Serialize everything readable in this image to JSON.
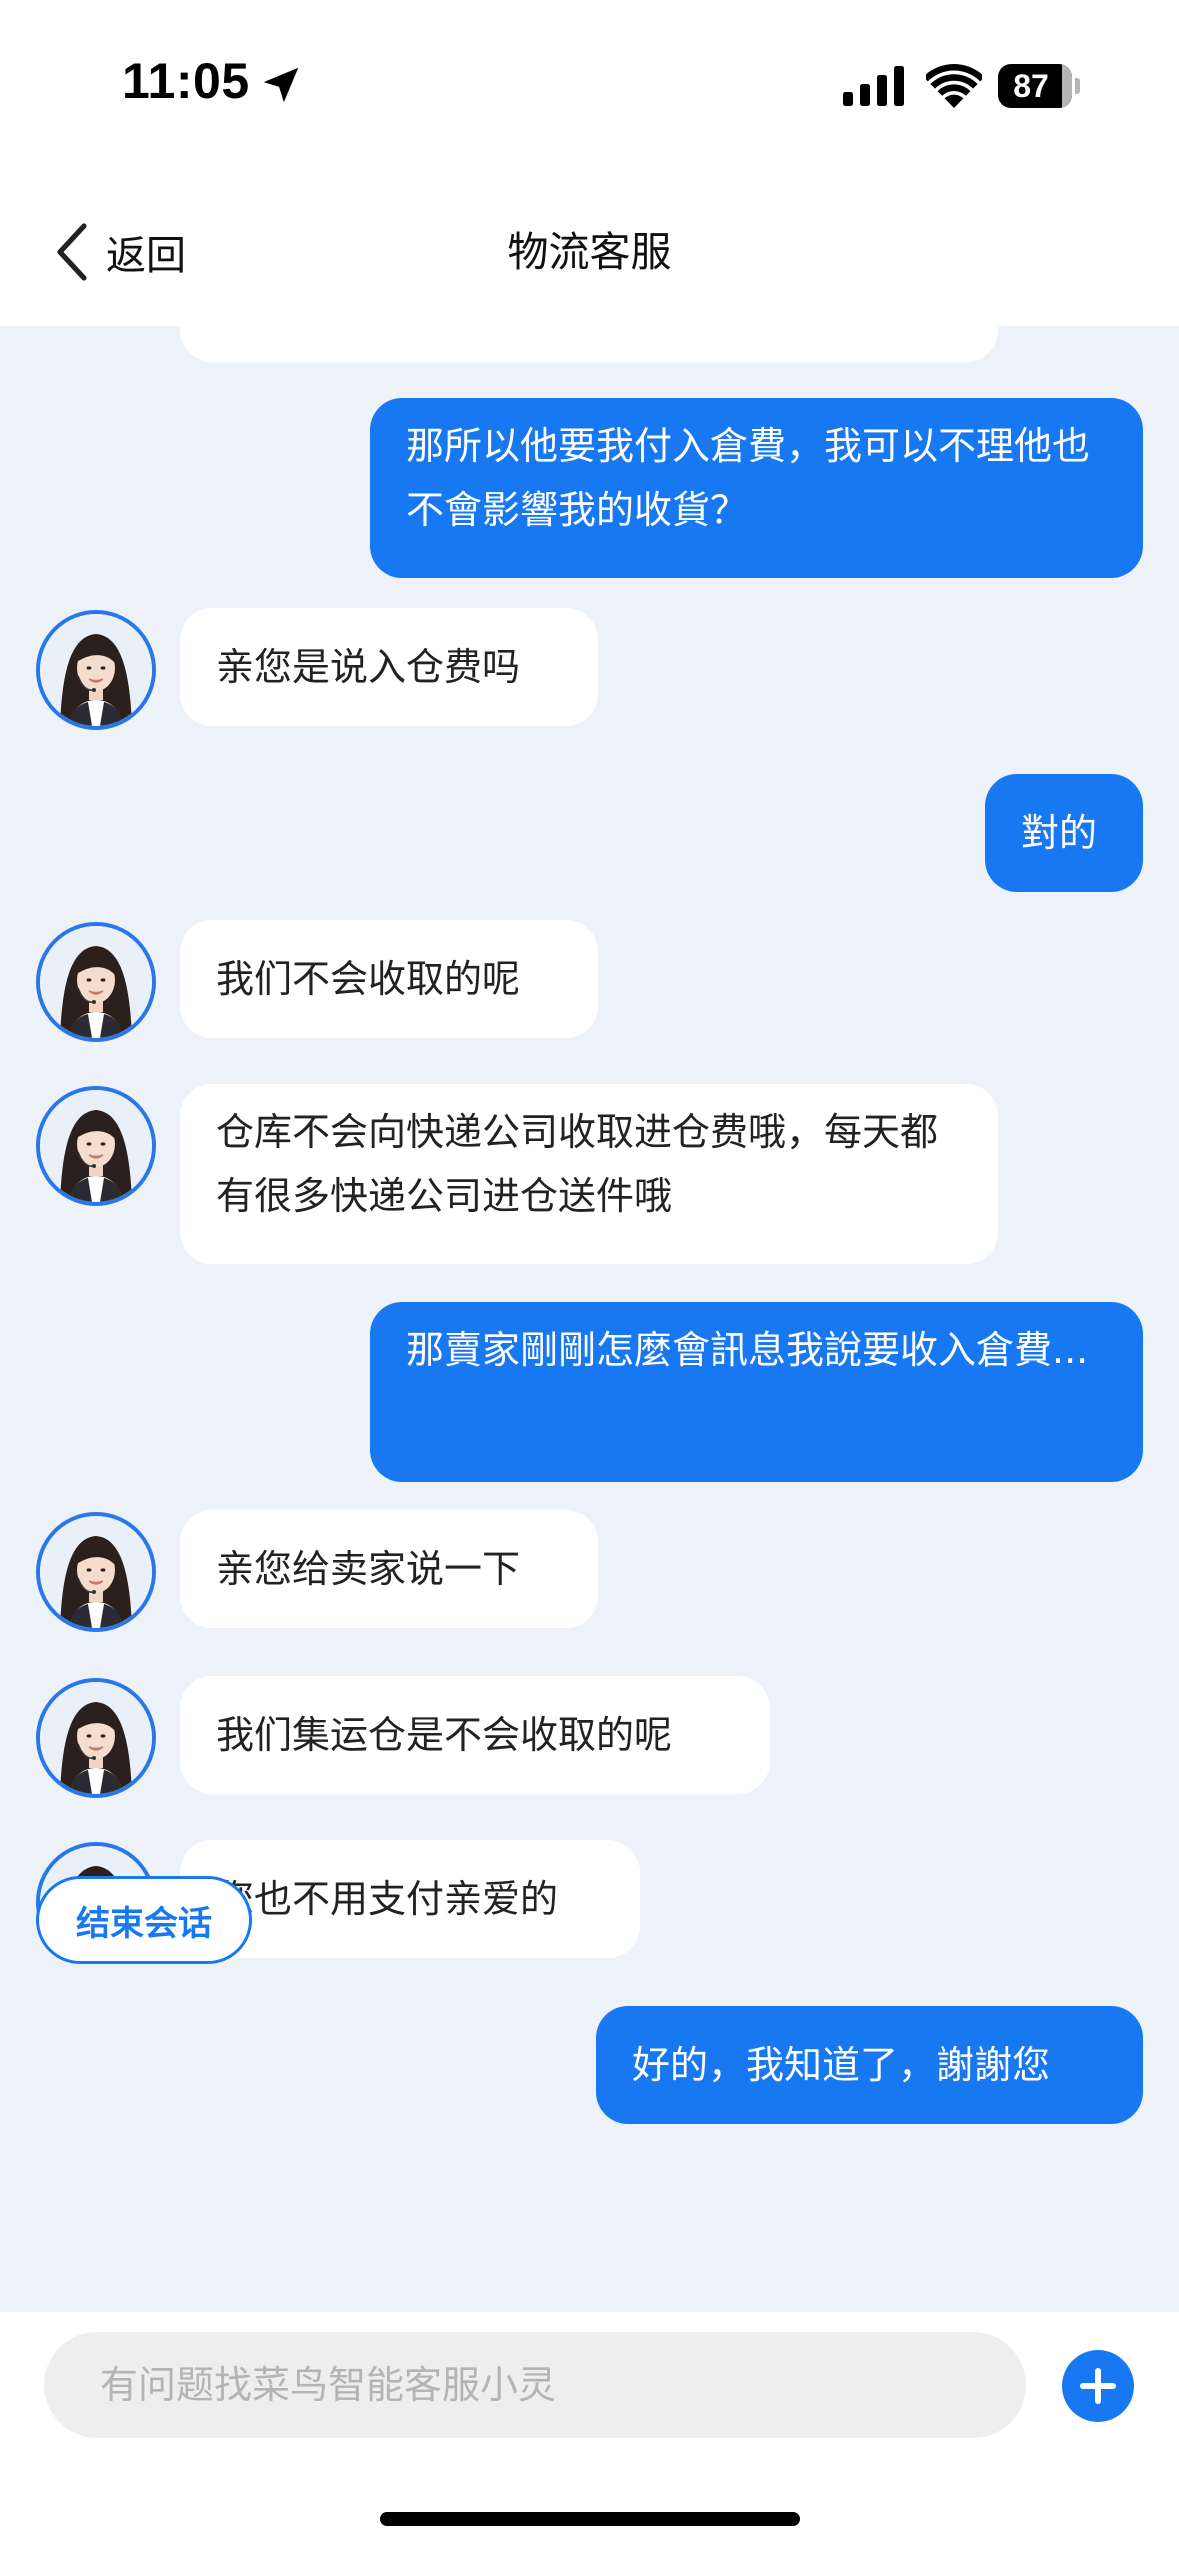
{
  "status_bar": {
    "time": "11:05",
    "battery": "87",
    "battery_level": 0.87,
    "icons": [
      "location-arrow-icon",
      "cellular-signal-icon",
      "wifi-icon",
      "battery-icon"
    ]
  },
  "nav": {
    "back_label": "返回",
    "title": "物流客服"
  },
  "messages": [
    {
      "sender": "user",
      "text": "那所以他要我付入倉費，我可以不理他也不會影響我的收貨？"
    },
    {
      "sender": "agent",
      "text": "亲您是说入仓费吗"
    },
    {
      "sender": "user",
      "text": "對的"
    },
    {
      "sender": "agent",
      "text": "我们不会收取的呢"
    },
    {
      "sender": "agent",
      "text": "仓库不会向快递公司收取进仓费哦，每天都有很多快递公司进仓送件哦"
    },
    {
      "sender": "user",
      "text": "那賣家剛剛怎麼會訊息我說要收入倉費..."
    },
    {
      "sender": "agent",
      "text": "亲您给卖家说一下"
    },
    {
      "sender": "agent",
      "text": "我们集运仓是不会收取的呢"
    },
    {
      "sender": "agent",
      "text": "您也不用支付亲爱的"
    },
    {
      "sender": "user",
      "text": "好的，我知道了，謝謝您"
    }
  ],
  "end_session_label": "结束会话",
  "input": {
    "placeholder": "有问题找菜鸟智能客服小灵",
    "value": ""
  },
  "colors": {
    "accent": "#1778f2",
    "chat_background": "#edf1f8",
    "agent_bubble": "#ffffff",
    "user_bubble": "#1778f2"
  }
}
